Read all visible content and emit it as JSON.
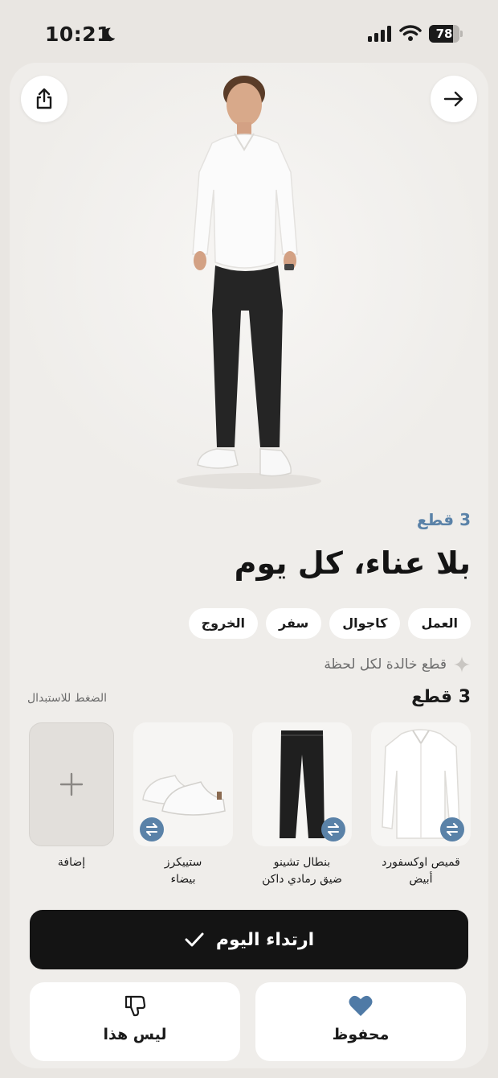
{
  "status_bar": {
    "time": "10:21",
    "battery": "78",
    "battery_level": 0.78
  },
  "outfit": {
    "pieces_count": "3 قطع",
    "title": "بلا عناء، كل يوم",
    "tags": [
      "العمل",
      "كاجوال",
      "سفر",
      "الخروج"
    ],
    "tagline": "قطع خالدة لكل لحظة"
  },
  "items_section": {
    "header": "3 قطع",
    "swap_hint": "الضغط للاستبدال",
    "items": [
      {
        "label_line1": "قميص اوكسفورد",
        "label_line2": "أبيض"
      },
      {
        "label_line1": "بنطال تشينو",
        "label_line2": "ضيق رمادي داكن"
      },
      {
        "label_line1": "ستييكرز",
        "label_line2": "بيضاء"
      }
    ],
    "add_label": "إضافة"
  },
  "actions": {
    "wear_today": "ارتداء اليوم",
    "dislike": "ليس هذا",
    "saved": "محفوظ"
  },
  "colors": {
    "accent": "#5a82a8",
    "primary_button": "#141414",
    "background": "#e9e6e2"
  }
}
